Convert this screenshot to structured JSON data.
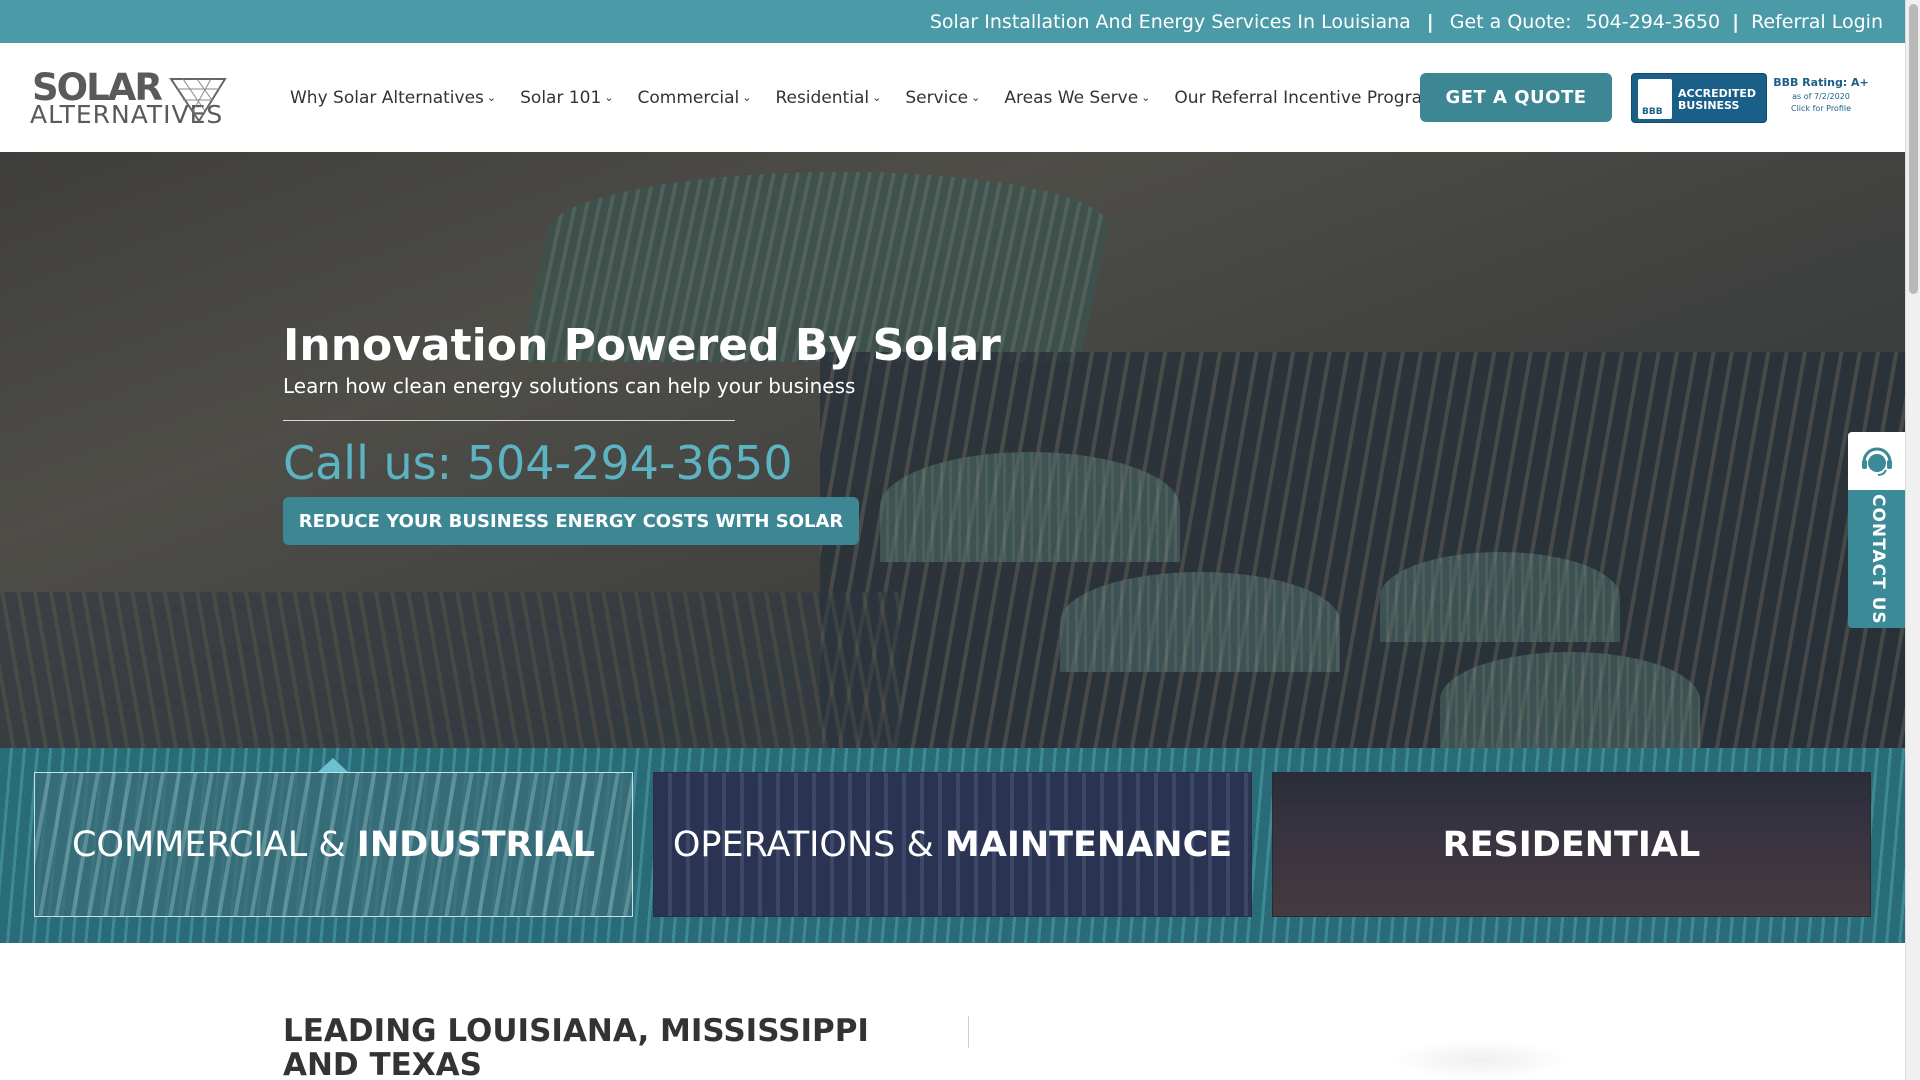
{
  "topbar": {
    "tagline": "Solar Installation And Energy Services In Louisiana",
    "separator": "|",
    "quote_label": "Get a Quote:",
    "phone": "504-294-3650",
    "separator2": "|",
    "referral_login": "Referral Login"
  },
  "logo": {
    "line1": "SOLAR",
    "line2": "ALTERNATIVES"
  },
  "nav": {
    "items": [
      {
        "label": "Why Solar Alternatives",
        "has_dropdown": true
      },
      {
        "label": "Solar 101",
        "has_dropdown": true
      },
      {
        "label": "Commercial",
        "has_dropdown": true
      },
      {
        "label": "Residential",
        "has_dropdown": true
      },
      {
        "label": "Service",
        "has_dropdown": true
      },
      {
        "label": "Areas We Serve",
        "has_dropdown": true
      },
      {
        "label": "Our Referral Incentive Program",
        "has_dropdown": false
      }
    ],
    "chevron": "⌄"
  },
  "header": {
    "cta": "GET A QUOTE"
  },
  "bbb": {
    "seal": "BBB",
    "accredited": "ACCREDITED BUSINESS",
    "rating": "BBB Rating: A+",
    "as_of": "as of 7/2/2020",
    "click": "Click for Profile"
  },
  "hero": {
    "title": "Innovation Powered By Solar",
    "subtitle": "Learn how clean energy solutions can help your business",
    "call": "Call us: 504-294-3650",
    "button": "REDUCE YOUR BUSINESS ENERGY COSTS WITH SOLAR"
  },
  "contact_tab": {
    "label": "CONTACT US",
    "icon": "support-headset-icon"
  },
  "services": [
    {
      "light": "COMMERCIAL & ",
      "bold": "INDUSTRIAL",
      "active": true
    },
    {
      "light": "OPERATIONS & ",
      "bold": "MAINTENANCE",
      "active": false
    },
    {
      "light": "",
      "bold": "RESIDENTIAL",
      "active": false
    }
  ],
  "lower": {
    "heading": "LEADING LOUISIANA, MISSISSIPPI AND TEXAS"
  },
  "colors": {
    "teal_topbar": "#4a9aa8",
    "teal_button": "#3d8794",
    "teal_text": "#5cb4c2",
    "bbb_blue": "#1a5f88"
  }
}
